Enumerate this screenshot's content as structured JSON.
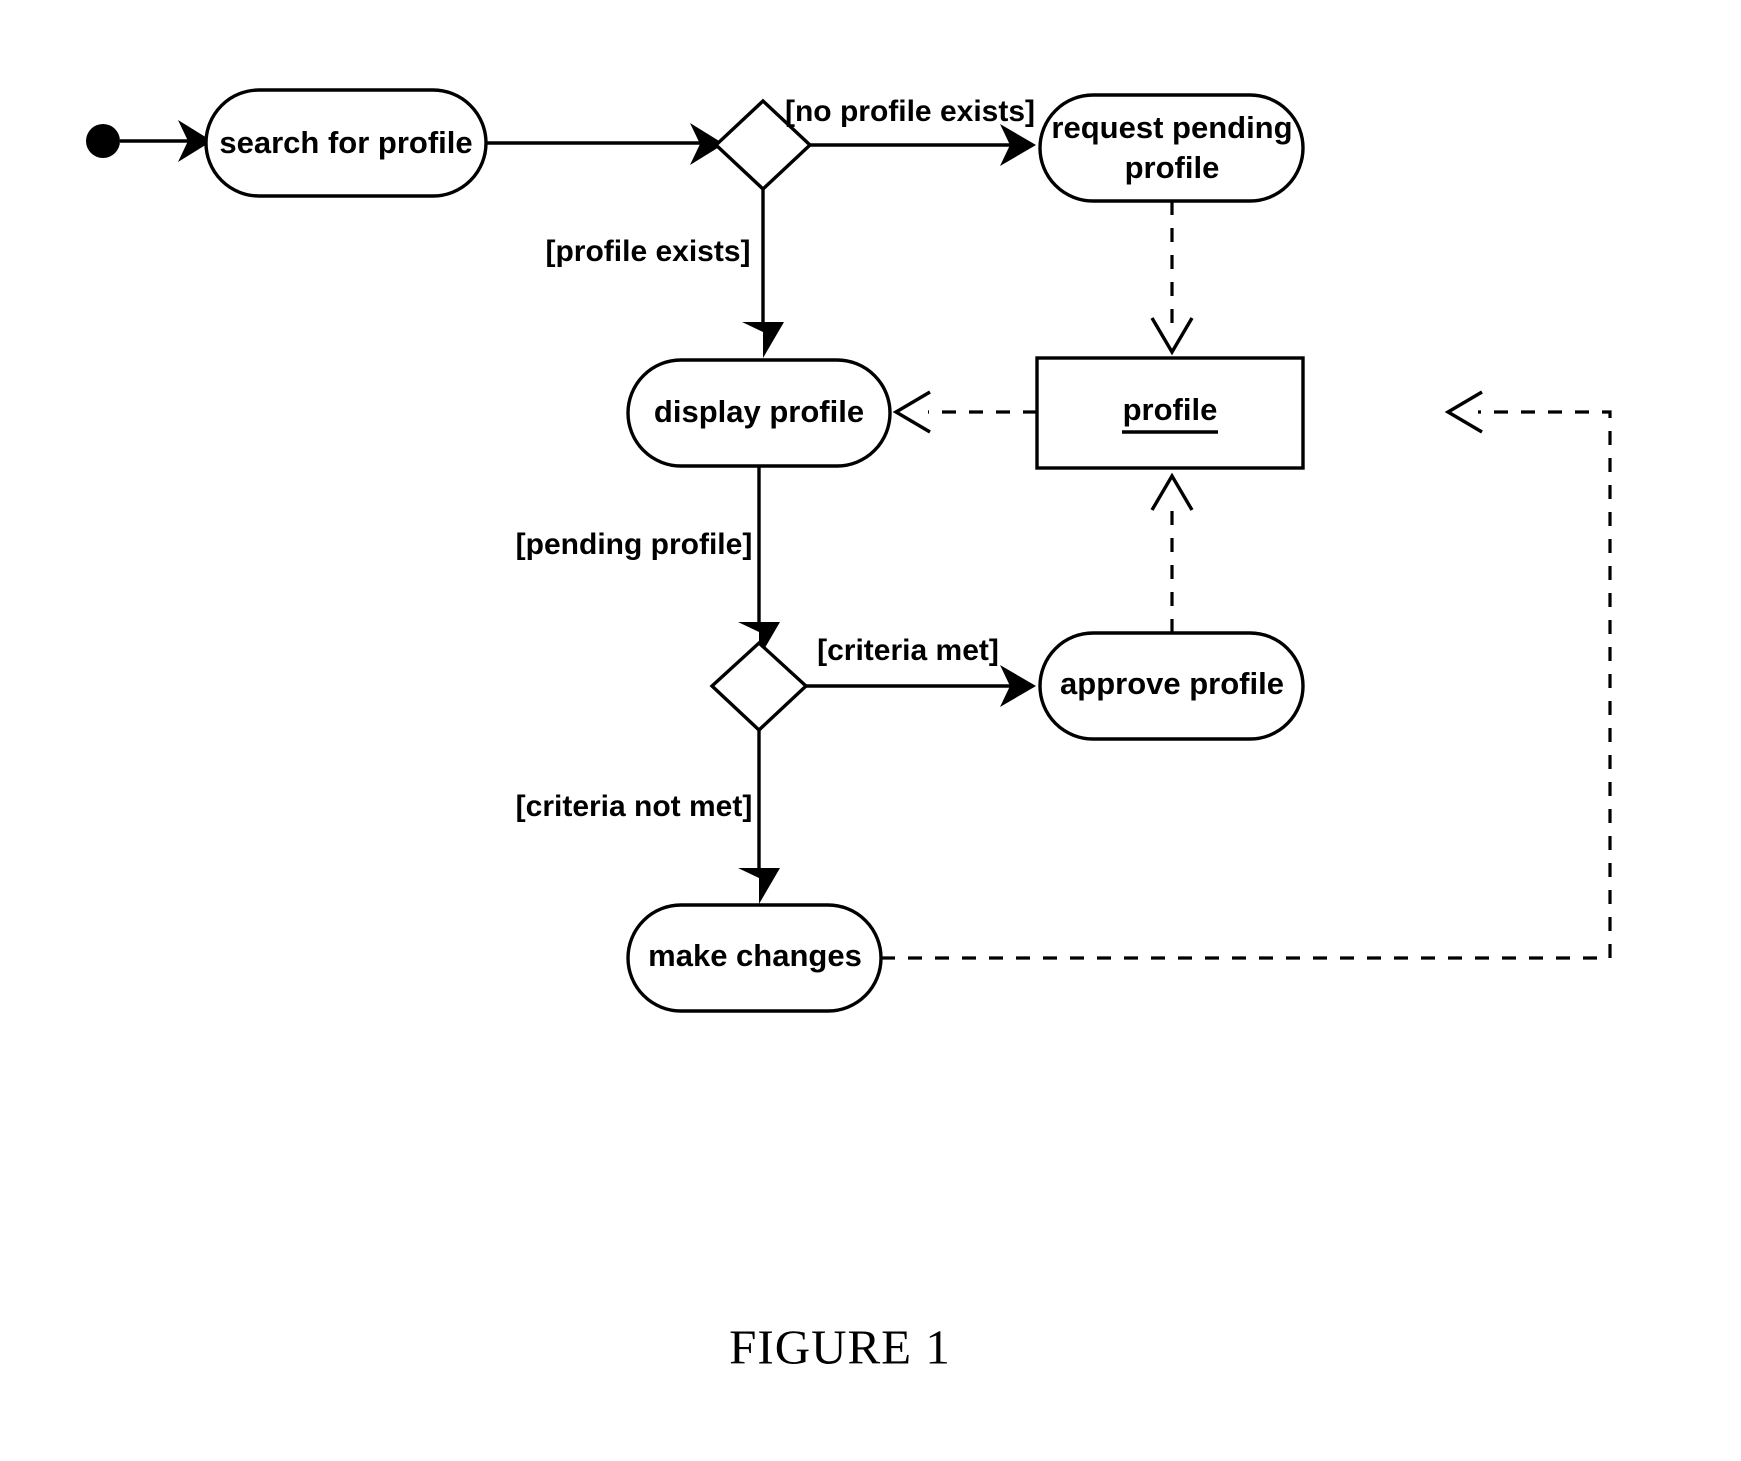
{
  "figure": {
    "caption": "FIGURE 1"
  },
  "diagram": {
    "type": "uml-activity-diagram",
    "nodes": [
      {
        "id": "start",
        "kind": "initial-node",
        "label": ""
      },
      {
        "id": "search",
        "kind": "action",
        "label": "search for profile"
      },
      {
        "id": "decision1",
        "kind": "decision",
        "label": ""
      },
      {
        "id": "request",
        "kind": "action",
        "label": "request pending",
        "label2": "profile"
      },
      {
        "id": "display",
        "kind": "action",
        "label": "display profile"
      },
      {
        "id": "profile",
        "kind": "object-node",
        "label": "profile"
      },
      {
        "id": "decision2",
        "kind": "decision",
        "label": ""
      },
      {
        "id": "approve",
        "kind": "action",
        "label": "approve profile"
      },
      {
        "id": "changes",
        "kind": "action",
        "label": "make changes"
      }
    ],
    "edges": [
      {
        "from": "start",
        "to": "search",
        "label": "",
        "style": "solid"
      },
      {
        "from": "search",
        "to": "decision1",
        "label": "",
        "style": "solid"
      },
      {
        "from": "decision1",
        "to": "request",
        "label": "[no profile exists]",
        "style": "solid"
      },
      {
        "from": "decision1",
        "to": "display",
        "label": "[profile exists]",
        "style": "solid"
      },
      {
        "from": "request",
        "to": "profile",
        "label": "",
        "style": "dashed"
      },
      {
        "from": "profile",
        "to": "display",
        "label": "",
        "style": "dashed"
      },
      {
        "from": "display",
        "to": "decision2",
        "label": "[pending profile]",
        "style": "solid"
      },
      {
        "from": "decision2",
        "to": "approve",
        "label": "[criteria met]",
        "style": "solid"
      },
      {
        "from": "decision2",
        "to": "changes",
        "label": "[criteria not met]",
        "style": "solid"
      },
      {
        "from": "approve",
        "to": "profile",
        "label": "",
        "style": "dashed"
      },
      {
        "from": "changes",
        "to": "profile",
        "label": "",
        "style": "dashed"
      }
    ],
    "labels": {
      "search_for_profile": "search for profile",
      "no_profile_exists": "[no profile exists]",
      "profile_exists": "[profile exists]",
      "request_pending_line1": "request pending",
      "request_pending_line2": "profile",
      "display_profile": "display profile",
      "profile_object": "profile",
      "pending_profile": "[pending profile]",
      "criteria_met": "[criteria met]",
      "criteria_not_met": "[criteria not met]",
      "approve_profile": "approve profile",
      "make_changes": "make changes"
    },
    "colors": {
      "stroke": "#000000",
      "fill": "#ffffff",
      "background": "#ffffff"
    }
  }
}
